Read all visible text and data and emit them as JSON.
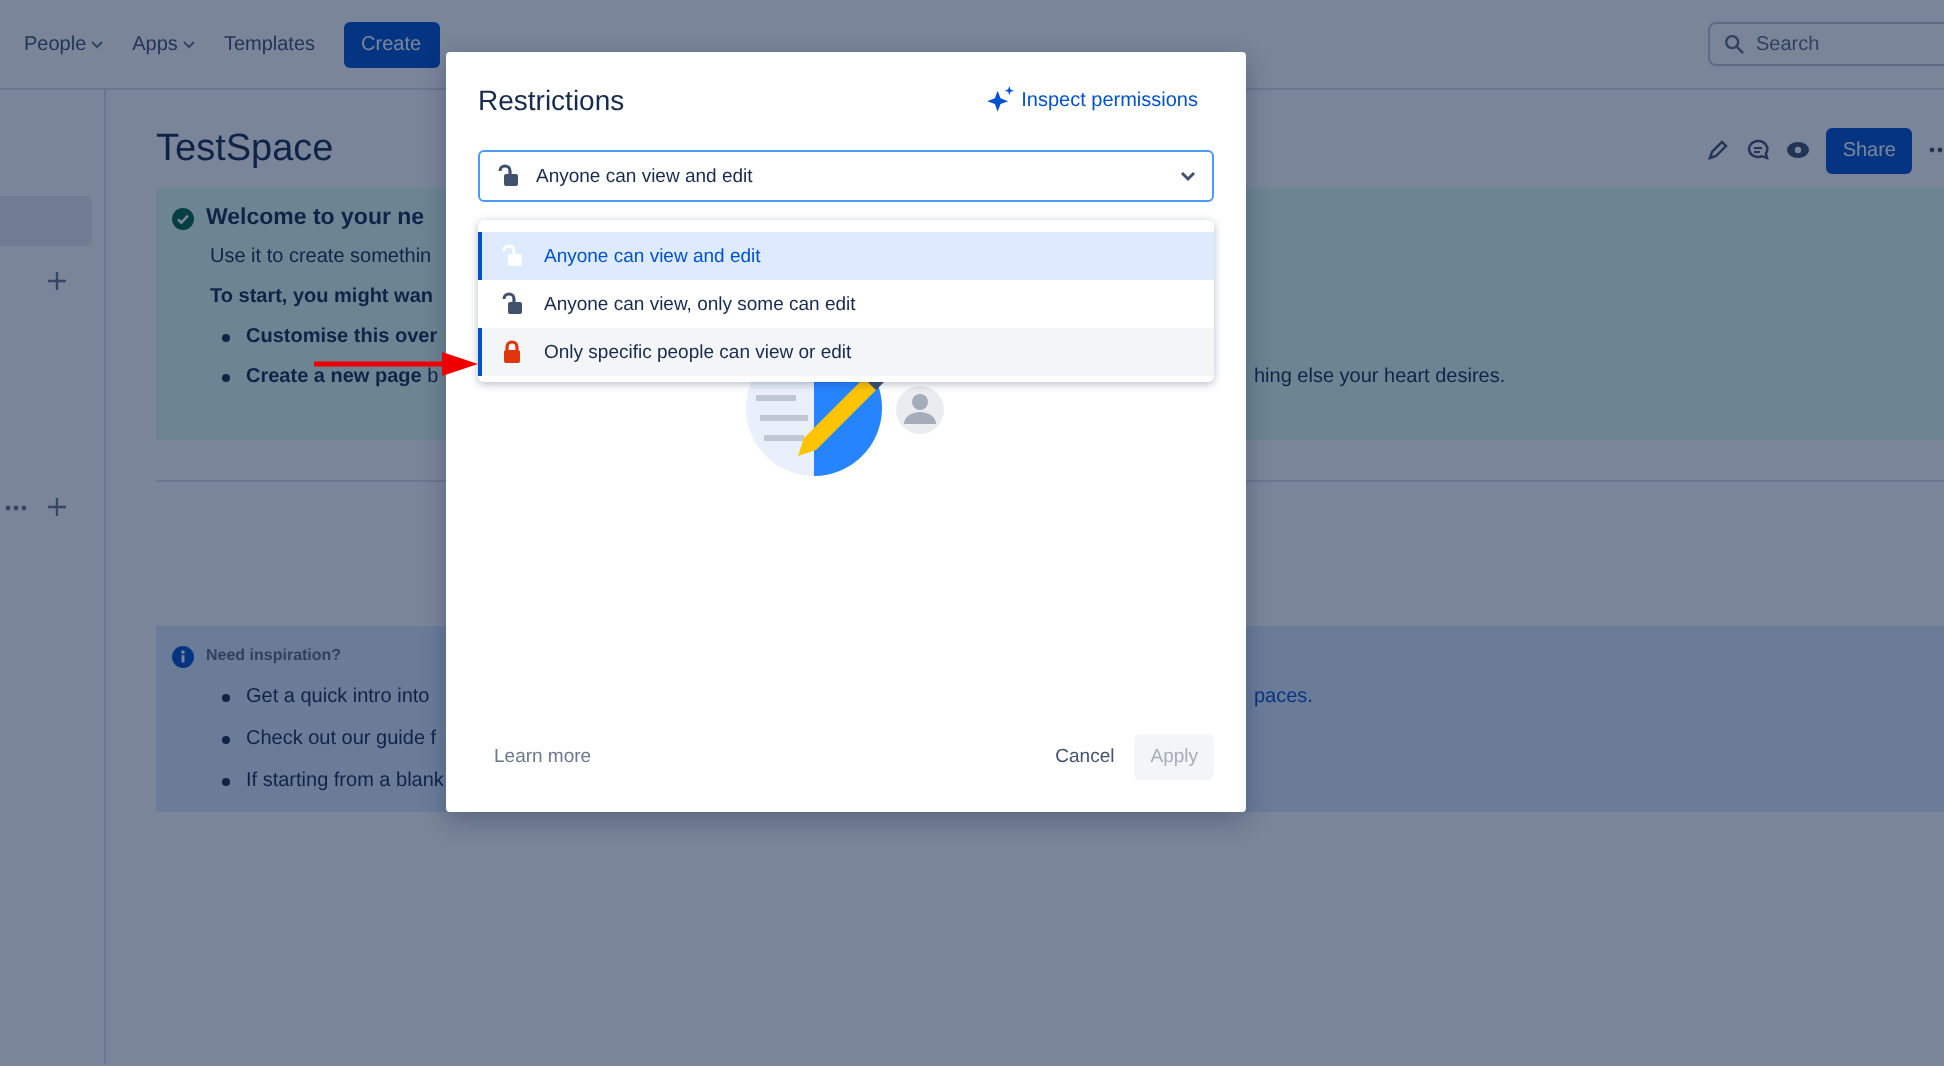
{
  "top_nav": {
    "items": [
      {
        "label": "People",
        "caret": true
      },
      {
        "label": "Apps",
        "caret": true
      },
      {
        "label": "Templates",
        "caret": false
      }
    ],
    "create_button": "Create",
    "search": {
      "placeholder": "Search"
    }
  },
  "page": {
    "title": "TestSpace",
    "share_button": "Share",
    "welcome_panel": {
      "heading": "Welcome to your ne",
      "lines": [
        {
          "kind": "text",
          "left": "Use it to create somethin"
        },
        {
          "kind": "bold",
          "left": "To start, you might wan"
        },
        {
          "kind": "bullet",
          "left": "**Customise this over**"
        },
        {
          "kind": "bullet",
          "left": "**Create a new page** b",
          "right": "hing else your heart desires."
        }
      ]
    },
    "info_panel": {
      "heading": "Need inspiration?",
      "lines": [
        {
          "kind": "bullet",
          "left": "Get a quick intro into",
          "right": "paces."
        },
        {
          "kind": "bullet",
          "left": "Check out our guide f"
        },
        {
          "kind": "bullet",
          "left": "If starting from a blank"
        }
      ]
    }
  },
  "dialog": {
    "title": "Restrictions",
    "inspect_link": "Inspect permissions",
    "select": {
      "value": "Anyone can view and edit",
      "kind": "open",
      "expanded": true
    },
    "options": [
      {
        "label": "Anyone can view and edit",
        "kind": "open",
        "selected": true,
        "highlighted": false
      },
      {
        "label": "Anyone can view, only some can edit",
        "kind": "open",
        "selected": false,
        "highlighted": false
      },
      {
        "label": "Only specific people can view or edit",
        "kind": "closed",
        "selected": false,
        "highlighted": true
      }
    ],
    "learn_more": "Learn more",
    "cancel_button": "Cancel",
    "apply_button": {
      "label": "Apply",
      "disabled": true
    }
  }
}
